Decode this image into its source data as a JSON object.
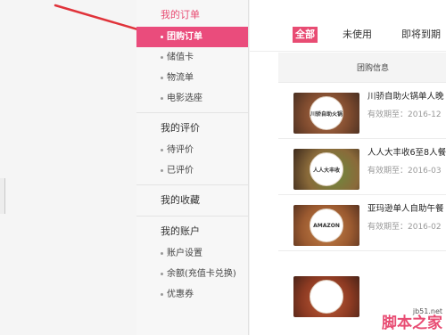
{
  "sidebar": {
    "groups": [
      {
        "title": "我的订单",
        "items": [
          {
            "label": "团购订单"
          },
          {
            "label": "储值卡"
          },
          {
            "label": "物流单"
          },
          {
            "label": "电影选座"
          }
        ]
      },
      {
        "title": "我的评价",
        "items": [
          {
            "label": "待评价"
          },
          {
            "label": "已评价"
          }
        ]
      },
      {
        "title": "我的收藏",
        "items": []
      },
      {
        "title": "我的账户",
        "items": [
          {
            "label": "账户设置"
          },
          {
            "label": "余额(充值卡兑换)"
          },
          {
            "label": "优惠券"
          }
        ]
      }
    ]
  },
  "tabs": [
    {
      "label": "全部"
    },
    {
      "label": "未使用"
    },
    {
      "label": "即将到期"
    }
  ],
  "table": {
    "header": "团购信息"
  },
  "orders": [
    {
      "title": "川骄自助火锅单人晚",
      "date": "有效期至：2016-12",
      "thumb_text": "川骄自助火锅"
    },
    {
      "title": "人人大丰收6至8人餐",
      "date": "有效期至：2016-03",
      "thumb_text": "人人大丰收"
    },
    {
      "title": "亚玛逊单人自助午餐",
      "date": "有效期至：2016-02",
      "thumb_text": "AMAZON"
    },
    {
      "title": "",
      "date": "",
      "thumb_text": ""
    }
  ],
  "watermark": {
    "url": "jb51.net",
    "text": "脚本之家"
  },
  "colors": {
    "accent": "#e84c73",
    "arrow": "#e0333a"
  }
}
